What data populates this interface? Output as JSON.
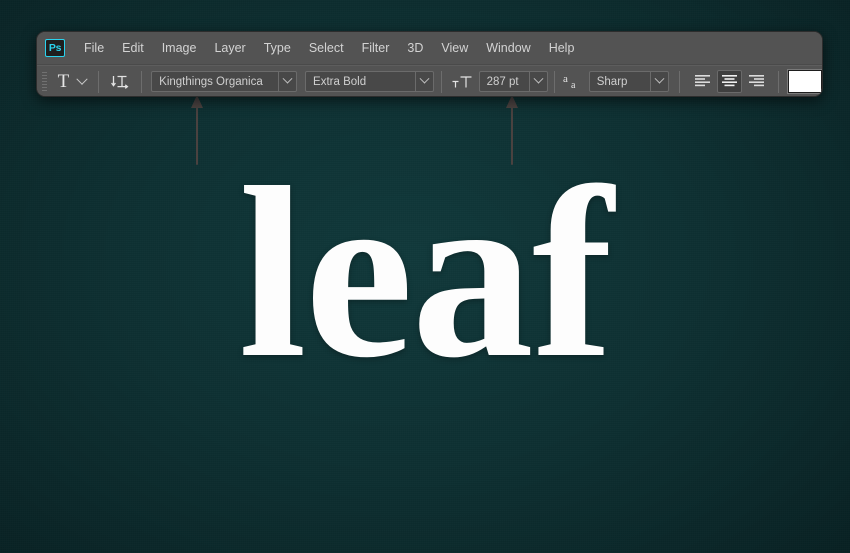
{
  "app": {
    "logo_text": "Ps",
    "accent_color": "#2ad3ee",
    "window_bg": "#535353",
    "canvas_color": "#0e3032"
  },
  "menubar": {
    "items": [
      {
        "label": "File"
      },
      {
        "label": "Edit"
      },
      {
        "label": "Image"
      },
      {
        "label": "Layer"
      },
      {
        "label": "Type"
      },
      {
        "label": "Select"
      },
      {
        "label": "Filter"
      },
      {
        "label": "3D"
      },
      {
        "label": "View"
      },
      {
        "label": "Window"
      },
      {
        "label": "Help"
      }
    ]
  },
  "options_bar": {
    "tool_icon": "T",
    "tool_preset_label": "T",
    "orientation_toggle": "toggle-text-orientation",
    "font_family": {
      "value": "Kingthings Organica",
      "placeholder": "Kingthings Organica"
    },
    "font_style": {
      "value": "Extra Bold",
      "placeholder": "Extra Bold"
    },
    "font_size": {
      "value": "287 pt",
      "placeholder": "287 pt"
    },
    "anti_alias": {
      "value": "Sharp",
      "placeholder": "Sharp"
    },
    "alignment": {
      "left": "Left align text",
      "center": "Center text",
      "right": "Right align text",
      "active": "center"
    },
    "color": {
      "label": "Set the text color",
      "value": "#ffffff"
    }
  },
  "annotations": {
    "arrow_font_family": "points-to-font-family-field",
    "arrow_font_size": "points-to-font-size-field"
  },
  "canvas": {
    "text": "leaf"
  }
}
